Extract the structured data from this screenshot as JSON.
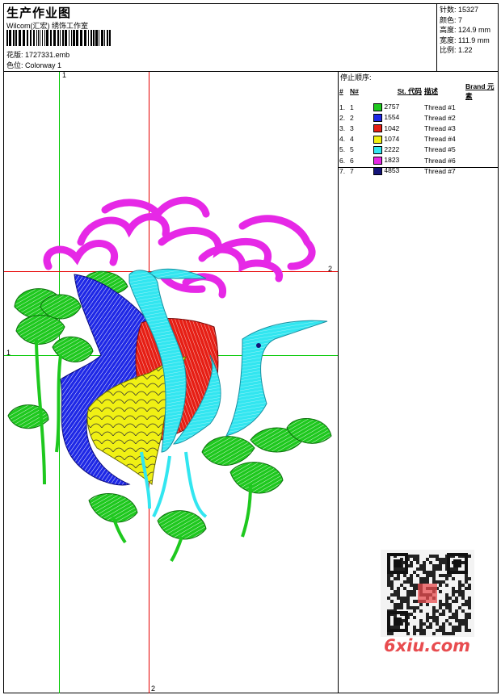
{
  "header": {
    "title": "生产作业图",
    "subtitle": "Wilcom(汇宏) 绣饰工作室",
    "design_label": "花版:",
    "design_value": "1727331.emb",
    "colorway_label": "色位:",
    "colorway_value": "Colorway 1"
  },
  "stats": [
    {
      "label": "针数:",
      "value": "15327"
    },
    {
      "label": "颜色:",
      "value": "7"
    },
    {
      "label": "高度:",
      "value": "124.9 mm"
    },
    {
      "label": "宽度:",
      "value": "111.9 mm"
    },
    {
      "label": "比例:",
      "value": "1.22"
    }
  ],
  "thread_table": {
    "title": "停止顺序:",
    "headers": {
      "index": "#",
      "no": "N#",
      "st": "St.",
      "code": "代码",
      "desc": "描述",
      "brand": "Brand",
      "elem": "元素"
    },
    "rows": [
      {
        "index": "1.",
        "no": "1",
        "color": "#1ec81e",
        "code": "2757",
        "desc": "Thread #1"
      },
      {
        "index": "2.",
        "no": "2",
        "color": "#1e28e6",
        "code": "1554",
        "desc": "Thread #2"
      },
      {
        "index": "3.",
        "no": "3",
        "color": "#e61e14",
        "code": "1042",
        "desc": "Thread #3"
      },
      {
        "index": "4.",
        "no": "4",
        "color": "#f0f014",
        "code": "1074",
        "desc": "Thread #4"
      },
      {
        "index": "5.",
        "no": "5",
        "color": "#32e6f0",
        "code": "2222",
        "desc": "Thread #5"
      },
      {
        "index": "6.",
        "no": "6",
        "color": "#e628e6",
        "code": "1823",
        "desc": "Thread #6"
      },
      {
        "index": "7.",
        "no": "7",
        "color": "#141478",
        "code": "4853",
        "desc": "Thread #7"
      }
    ]
  },
  "guides": {
    "green_top": "1",
    "green_left": "1",
    "red_right": "2",
    "red_bottom": "2"
  },
  "watermark": {
    "logo_text": "6xiu.com"
  },
  "colors": {
    "green_guide": "#00c800",
    "red_guide": "#e60000",
    "leaf_green": "#1ec81e",
    "blue": "#1e28e6",
    "red": "#e61e14",
    "yellow": "#f0f014",
    "cyan": "#32e6f0",
    "magenta": "#e628e6",
    "logo": "#e84c4f"
  }
}
